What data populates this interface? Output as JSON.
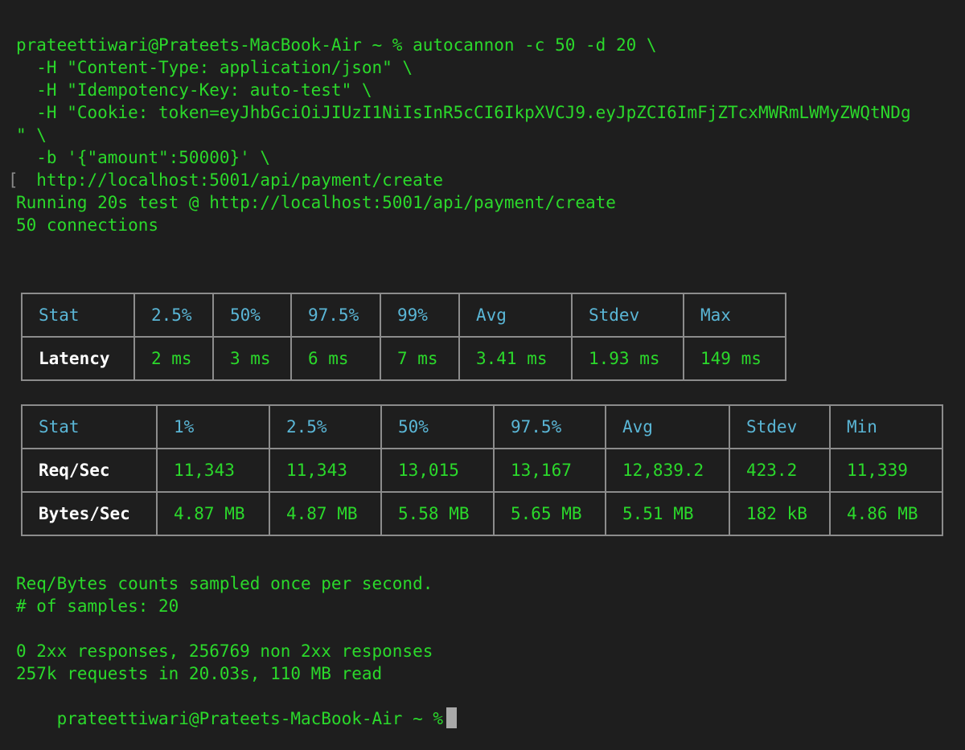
{
  "terminal": {
    "command_lines": [
      "prateettiwari@Prateets-MacBook-Air ~ % autocannon -c 50 -d 20 \\",
      "  -H \"Content-Type: application/json\" \\",
      "  -H \"Idempotency-Key: auto-test\" \\",
      "  -H \"Cookie: token=eyJhbGciOiJIUzI1NiIsInR5cCI6IkpXVCJ9.eyJpZCI6ImFjZTcxMWRmLWMyZWQtNDg",
      "\" \\",
      "  -b '{\"amount\":50000}' \\",
      "  http://localhost:5001/api/payment/create"
    ],
    "marker": "[",
    "output_lines": [
      "Running 20s test @ http://localhost:5001/api/payment/create",
      "50 connections"
    ],
    "latency_table": {
      "headers": [
        "Stat",
        "2.5%",
        "50%",
        "97.5%",
        "99%",
        "Avg",
        "Stdev",
        "Max"
      ],
      "rows": [
        {
          "label": "Latency",
          "values": [
            "2 ms",
            "3 ms",
            "6 ms",
            "7 ms",
            "3.41 ms",
            "1.93 ms",
            "149 ms"
          ]
        }
      ]
    },
    "throughput_table": {
      "headers": [
        "Stat",
        "1%",
        "2.5%",
        "50%",
        "97.5%",
        "Avg",
        "Stdev",
        "Min"
      ],
      "rows": [
        {
          "label": "Req/Sec",
          "values": [
            "11,343",
            "11,343",
            "13,015",
            "13,167",
            "12,839.2",
            "423.2",
            "11,339"
          ]
        },
        {
          "label": "Bytes/Sec",
          "values": [
            "4.87 MB",
            "4.87 MB",
            "5.58 MB",
            "5.65 MB",
            "5.51 MB",
            "182 kB",
            "4.86 MB"
          ]
        }
      ]
    },
    "summary_lines": [
      "Req/Bytes counts sampled once per second.",
      "# of samples: 20",
      "0 2xx responses, 256769 non 2xx responses",
      "257k requests in 20.03s, 110 MB read"
    ],
    "prompt": "prateettiwari@Prateets-MacBook-Air ~ %"
  },
  "colors": {
    "background": "#1e1e1e",
    "text_green": "#2bd92b",
    "header_cyan": "#5ab6d6",
    "label_white": "#ffffff",
    "table_border": "#8c8c8c",
    "cursor": "#a9a9a9"
  }
}
